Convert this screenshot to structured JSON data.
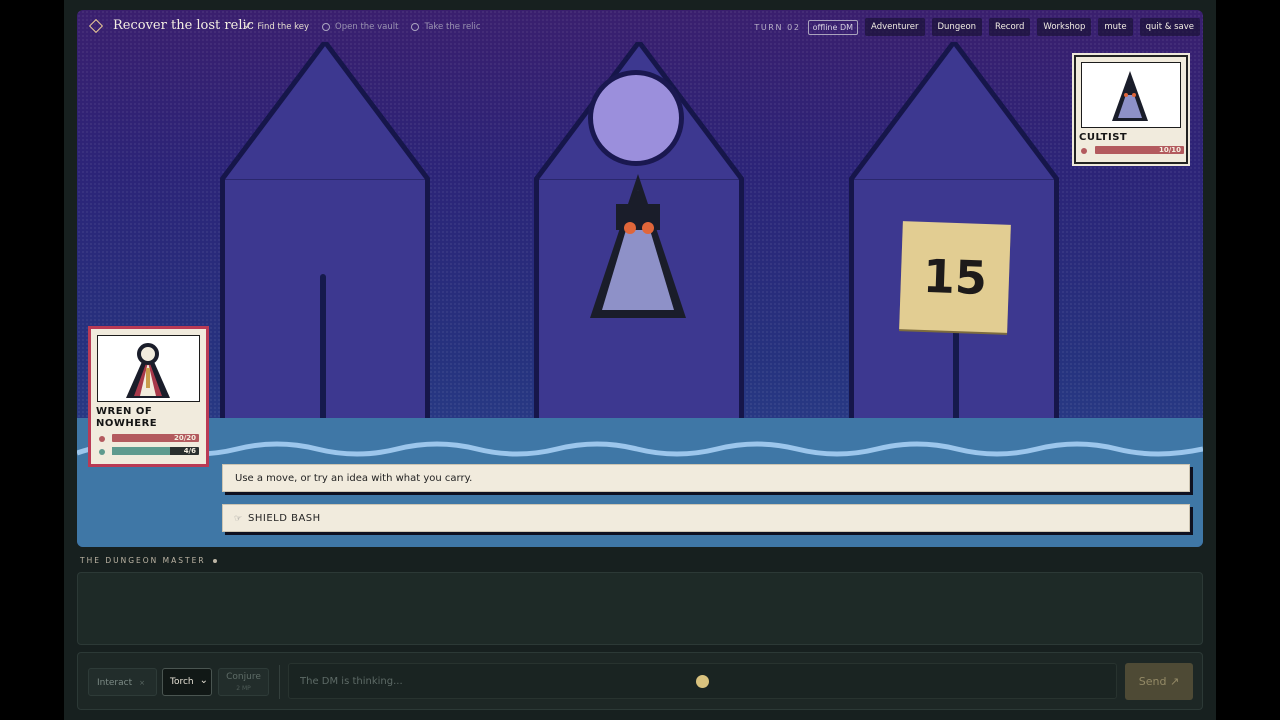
{
  "quest": {
    "title": "Recover the lost relic",
    "objectives": [
      {
        "label": "Find the key",
        "done": true
      },
      {
        "label": "Open the vault",
        "done": false
      },
      {
        "label": "Take the relic",
        "done": false
      }
    ]
  },
  "toolbar": {
    "turn": "TURN 02",
    "mode_badge": "offline DM",
    "buttons": [
      "Adventurer",
      "Dungeon",
      "Record",
      "Workshop",
      "mute",
      "quit & save"
    ]
  },
  "enemy": {
    "name": "CULTIST",
    "hp": {
      "current": 10,
      "max": 10,
      "label": "10/10",
      "color": "#b35a5e"
    }
  },
  "hero": {
    "name_line1": "WREN OF",
    "name_line2": "NOWHERE",
    "hp": {
      "current": 20,
      "max": 20,
      "label": "20/20",
      "color": "#b35a5e"
    },
    "mp": {
      "current": 4,
      "max": 6,
      "label": "4/6",
      "color": "#5e9a8e"
    }
  },
  "dice": {
    "value": "15"
  },
  "prompt": {
    "text": "Use a move, or try an idea with what you carry."
  },
  "move": {
    "icon": "☞",
    "label": "SHIELD BASH"
  },
  "dm": {
    "label": "THE DUNGEON MASTER"
  },
  "input": {
    "interact_label": "Interact",
    "interact_icon": "×",
    "item_selected": "Torch",
    "conjure_label": "Conjure",
    "conjure_cost": "2 MP",
    "placeholder": "The DM is thinking...",
    "send_label": "Send ↗"
  },
  "colors": {
    "accent": "#d9c27e",
    "hero_border": "#b93a55",
    "sky_top": "#3a1f6e",
    "ground": "#3f77a6"
  }
}
